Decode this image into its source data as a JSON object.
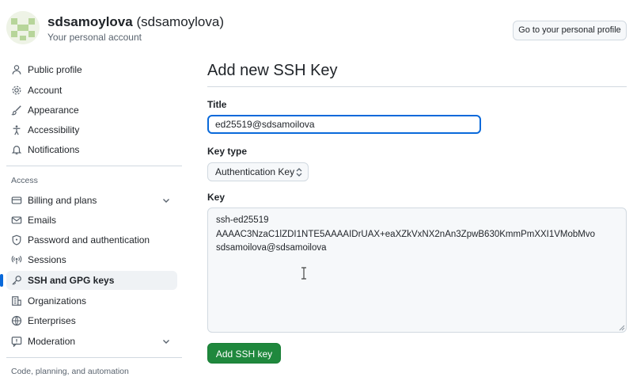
{
  "header": {
    "display_name": "sdsamoylova",
    "handle": "(sdsamoylova)",
    "subtitle": "Your personal account",
    "profile_button": "Go to your personal profile"
  },
  "sidebar": {
    "items": [
      {
        "label": "Public profile",
        "icon": "person-icon"
      },
      {
        "label": "Account",
        "icon": "gear-icon"
      },
      {
        "label": "Appearance",
        "icon": "paintbrush-icon"
      },
      {
        "label": "Accessibility",
        "icon": "accessibility-icon"
      },
      {
        "label": "Notifications",
        "icon": "bell-icon"
      }
    ],
    "access_heading": "Access",
    "access_items": [
      {
        "label": "Billing and plans",
        "icon": "credit-card-icon",
        "expandable": true
      },
      {
        "label": "Emails",
        "icon": "mail-icon"
      },
      {
        "label": "Password and authentication",
        "icon": "shield-icon"
      },
      {
        "label": "Sessions",
        "icon": "broadcast-icon"
      },
      {
        "label": "SSH and GPG keys",
        "icon": "key-icon",
        "active": true
      },
      {
        "label": "Organizations",
        "icon": "organization-icon"
      },
      {
        "label": "Enterprises",
        "icon": "globe-icon"
      },
      {
        "label": "Moderation",
        "icon": "report-icon",
        "expandable": true
      }
    ],
    "code_heading": "Code, planning, and automation"
  },
  "main": {
    "title": "Add new SSH Key",
    "title_label": "Title",
    "title_value": "ed25519@sdsamoilova",
    "key_type_label": "Key type",
    "key_type_value": "Authentication Key",
    "key_label": "Key",
    "key_lines": [
      "ssh-ed25519",
      "AAAAC3NzaC1lZDI1NTE5AAAAIDrUAX+eaXZkVxNX2nAn3ZpwB630KmmPmXXI1VMobMvo",
      "sdsamoilova@sdsamoilova"
    ],
    "submit_label": "Add SSH key"
  },
  "colors": {
    "accent": "#0969da",
    "primary_button": "#1f883d",
    "active_nav_bg": "#eff2f5"
  }
}
